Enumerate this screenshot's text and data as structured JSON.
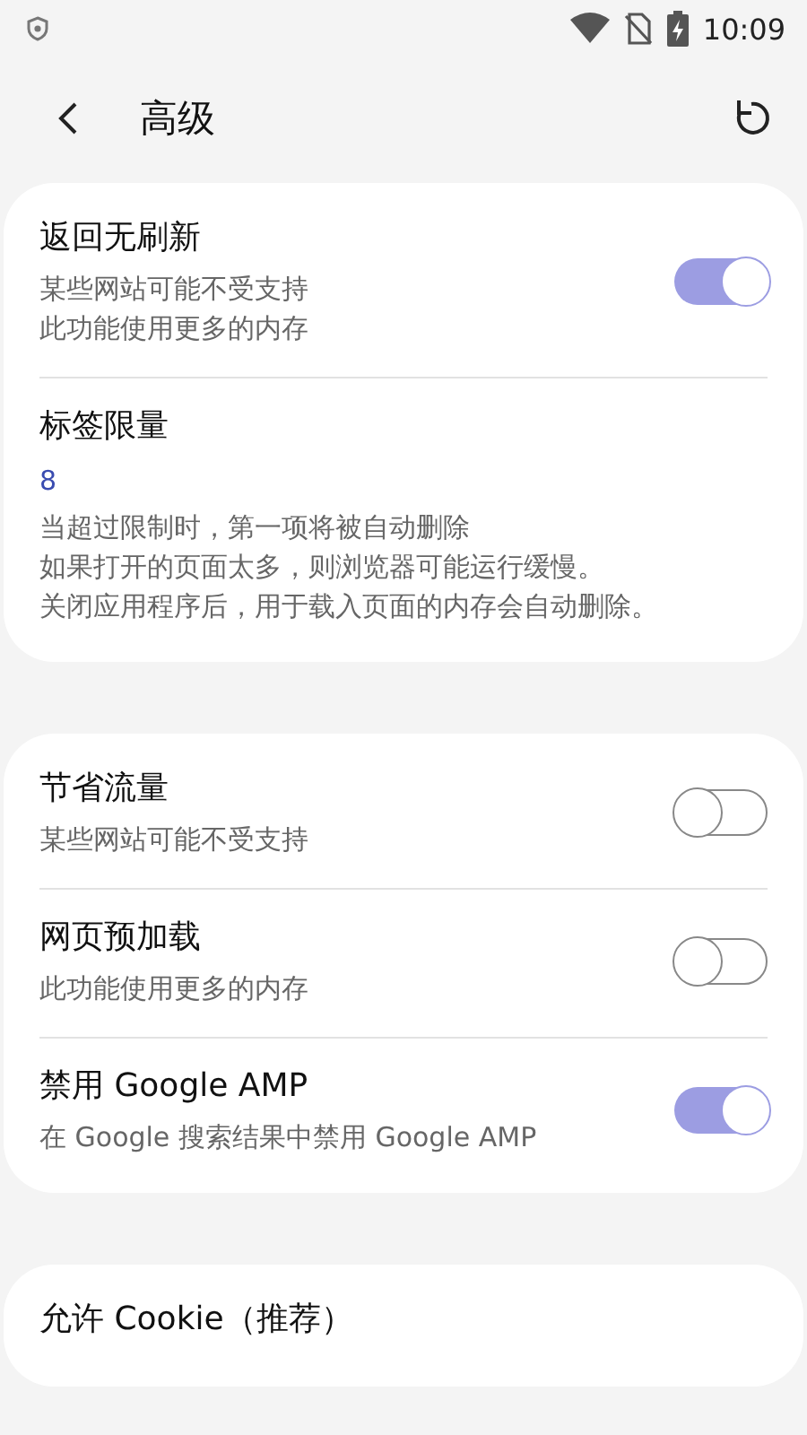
{
  "status_bar": {
    "time": "10:09"
  },
  "header": {
    "title": "高级"
  },
  "groups": [
    {
      "items": [
        {
          "kind": "switch",
          "title": "返回无刷新",
          "lines": [
            "某些网站可能不受支持",
            "此功能使用更多的内存"
          ],
          "on": true
        },
        {
          "kind": "value",
          "title": "标签限量",
          "value": "8",
          "lines": [
            "当超过限制时，第一项将被自动删除",
            "如果打开的页面太多，则浏览器可能运行缓慢。",
            "关闭应用程序后，用于载入页面的内存会自动删除。"
          ]
        }
      ]
    },
    {
      "items": [
        {
          "kind": "switch",
          "title": "节省流量",
          "lines": [
            "某些网站可能不受支持"
          ],
          "on": false
        },
        {
          "kind": "switch",
          "title": "网页预加载",
          "lines": [
            "此功能使用更多的内存"
          ],
          "on": false
        },
        {
          "kind": "switch",
          "title": "禁用 Google AMP",
          "lines": [
            "在 Google 搜索结果中禁用 Google AMP"
          ],
          "on": true
        }
      ]
    },
    {
      "items": [
        {
          "kind": "plain",
          "title": "允许 Cookie（推荐）"
        }
      ]
    }
  ]
}
